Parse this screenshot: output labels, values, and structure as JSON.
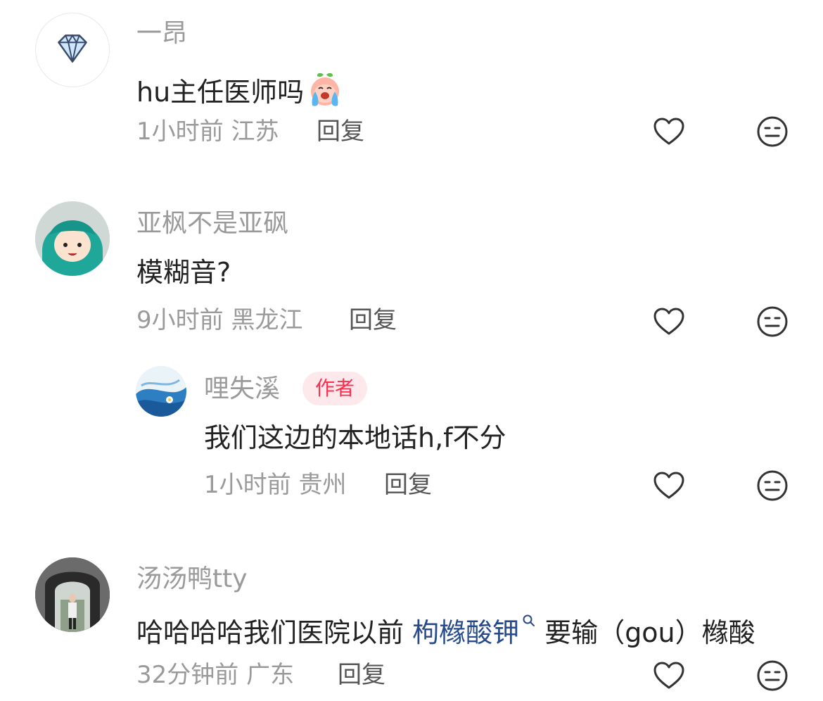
{
  "comments": [
    {
      "username": "一昂",
      "text": "hu主任医师吗",
      "emoji": "crying-peach-emoji",
      "time": "1小时前",
      "location": "江苏",
      "reply_label": "回复"
    },
    {
      "username": "亚枫不是亚砜",
      "text": "模糊音?",
      "time": "9小时前",
      "location": "黑龙江",
      "reply_label": "回复"
    },
    {
      "username": "汤汤鸭tty",
      "text_before": "哈哈哈哈我们医院以前 ",
      "link_text": "枸橼酸钾",
      "text_after": " 要输（gou）橼酸",
      "time": "32分钟前",
      "location": "广东",
      "reply_label": "回复"
    }
  ],
  "reply": {
    "username": "哩失溪",
    "badge": "作者",
    "text": "我们这边的本地话h,f不分",
    "time": "1小时前",
    "location": "贵州",
    "reply_label": "回复"
  },
  "icons": {
    "like": "heart-outline-icon",
    "dislike": "neutral-face-icon",
    "search": "search-icon"
  },
  "colors": {
    "text_primary": "#222222",
    "text_secondary": "#9a9a9a",
    "link": "#264a8c",
    "badge_bg": "#fde8ec",
    "badge_text": "#ff2e4d",
    "icon_stroke": "#333333"
  }
}
